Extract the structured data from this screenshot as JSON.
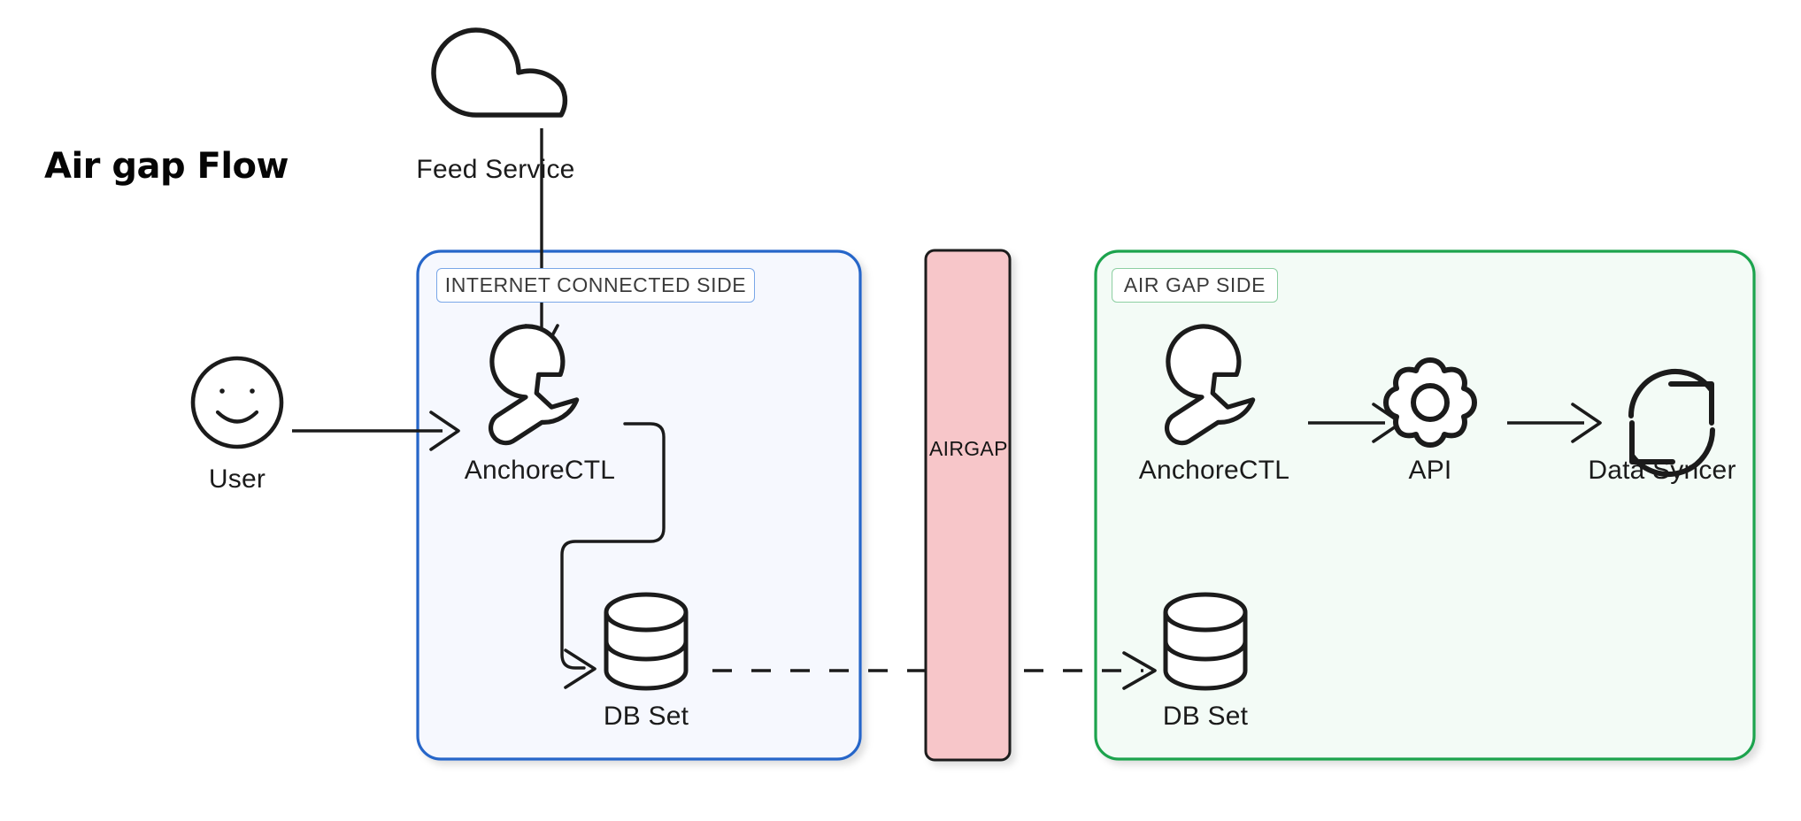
{
  "diagram": {
    "title": "Air gap Flow",
    "background_color": "#ffffff"
  },
  "nodes": {
    "feed_service": {
      "label": "Feed Service",
      "icon": "cloud-icon"
    },
    "user": {
      "label": "User",
      "icon": "smiley-face-icon"
    },
    "anchorectl_left": {
      "label": "AnchoreCTL",
      "icon": "wrench-icon"
    },
    "db_set_left": {
      "label": "DB Set",
      "icon": "database-cylinder-icon"
    },
    "anchorectl_right": {
      "label": "AnchoreCTL",
      "icon": "wrench-icon"
    },
    "api": {
      "label": "API",
      "icon": "gear-icon"
    },
    "data_syncer": {
      "label": "Data Syncer",
      "icon": "sync-arrows-icon"
    },
    "db_set_right": {
      "label": "DB Set",
      "icon": "database-cylinder-icon"
    }
  },
  "groups": {
    "internet_side": {
      "label": "INTERNET CONNECTED SIDE",
      "border_color": "#2866c9",
      "fill_color": "#f6f8fe"
    },
    "airgap_bar": {
      "label": "AIRGAP",
      "border_color": "#1b1b1b",
      "fill_color": "#f7c6c9"
    },
    "airgap_side": {
      "label": "AIR GAP SIDE",
      "border_color": "#1da34e",
      "fill_color": "#f3fbf6"
    }
  },
  "connectors": [
    {
      "name": "feed-to-anchorectl",
      "style": "solid-arrow"
    },
    {
      "name": "user-to-anchorectl",
      "style": "solid-arrow"
    },
    {
      "name": "anchorectl-to-dbset",
      "style": "solid-elbow-arrow"
    },
    {
      "name": "dbset-left-to-dbset-right",
      "style": "dashed-arrow"
    },
    {
      "name": "anchorectl-to-api",
      "style": "solid-arrow"
    },
    {
      "name": "api-to-data-syncer",
      "style": "solid-arrow"
    }
  ]
}
